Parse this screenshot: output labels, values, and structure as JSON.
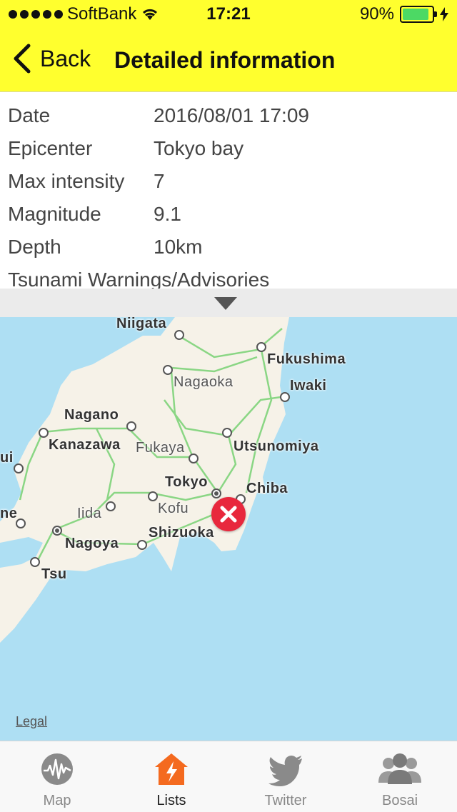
{
  "status_bar": {
    "carrier": "SoftBank",
    "time": "17:21",
    "battery": "90%"
  },
  "nav": {
    "back_label": "Back",
    "title": "Detailed information"
  },
  "details": [
    {
      "label": "Date",
      "value": "2016/08/01 17:09"
    },
    {
      "label": "Epicenter",
      "value": "Tokyo bay"
    },
    {
      "label": "Max intensity",
      "value": "7"
    },
    {
      "label": "Magnitude",
      "value": "9.1"
    },
    {
      "label": "Depth",
      "value": "10km"
    }
  ],
  "tsunami_label": "Tsunami Warnings/Advisories",
  "map": {
    "cities": [
      "Niigata",
      "Fukushima",
      "Nagaoka",
      "Iwaki",
      "Nagano",
      "Utsunomiya",
      "Kanazawa",
      "Fukaya",
      "Tokyo",
      "Chiba",
      "Kofu",
      "Iida",
      "Shizuoka",
      "Nagoya",
      "Tsu",
      "ui",
      "ne"
    ],
    "legal_label": "Legal"
  },
  "tabs": [
    {
      "label": "Map",
      "icon": "wave-icon"
    },
    {
      "label": "Lists",
      "icon": "house-alert-icon"
    },
    {
      "label": "Twitter",
      "icon": "twitter-bird-icon"
    },
    {
      "label": "Bosai",
      "icon": "people-icon"
    }
  ],
  "colors": {
    "header": "#ffff2e",
    "active_tab": "#f46a1f",
    "marker": "#e8283d",
    "sea": "#aedff3",
    "land": "#f6f2e8",
    "roads": "#7fd47a"
  }
}
